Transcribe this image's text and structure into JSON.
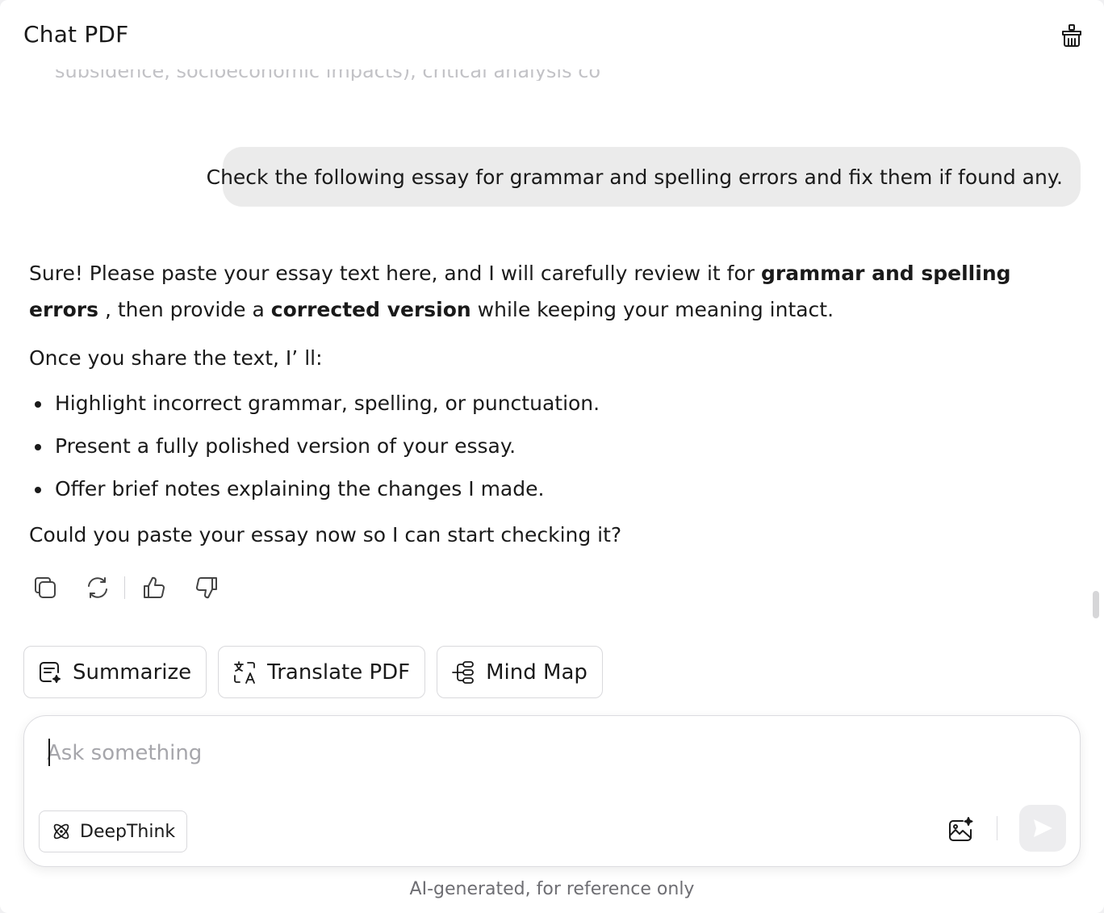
{
  "header": {
    "title": "Chat PDF",
    "clear_icon": "trash-icon"
  },
  "history": {
    "faded_text": "subsidence, socioeconomic impacts), critical analysis co"
  },
  "user_message": {
    "text": "Check the following essay for grammar and spelling errors and fix them if found any."
  },
  "assistant_message": {
    "p1_a": "Sure! Please paste your essay text here, and I will carefully review it for ",
    "p1_b": "grammar and spelling errors",
    "p1_c": " , then provide a ",
    "p1_d": "corrected version",
    "p1_e": " while keeping your meaning intact.",
    "p2": "Once you share the text, I’ ll:",
    "bullets": [
      "Highlight incorrect grammar, spelling, or punctuation.",
      "Present a fully polished version of your essay.",
      "Offer brief notes explaining the changes I made."
    ],
    "p3": "Could you paste your essay now so I can start checking it?"
  },
  "message_actions": {
    "icons": [
      "copy-icon",
      "regenerate-icon",
      "thumbs-up-icon",
      "thumbs-down-icon"
    ]
  },
  "quick_actions": [
    {
      "label": "Summarize",
      "icon": "summarize-icon"
    },
    {
      "label": "Translate PDF",
      "icon": "translate-icon"
    },
    {
      "label": "Mind Map",
      "icon": "mind-map-icon"
    }
  ],
  "composer": {
    "placeholder": "Ask something",
    "value": "",
    "deepthink_label": "DeepThink",
    "image_icon": "image-sparkle-icon",
    "send_icon": "send-icon"
  },
  "footer": {
    "disclaimer": "AI-generated, for reference only"
  },
  "colors": {
    "bubble": "#ebebeb",
    "border": "#d9d9dc",
    "placeholder": "#a6a6ab",
    "send_disabled": "#ededef"
  }
}
